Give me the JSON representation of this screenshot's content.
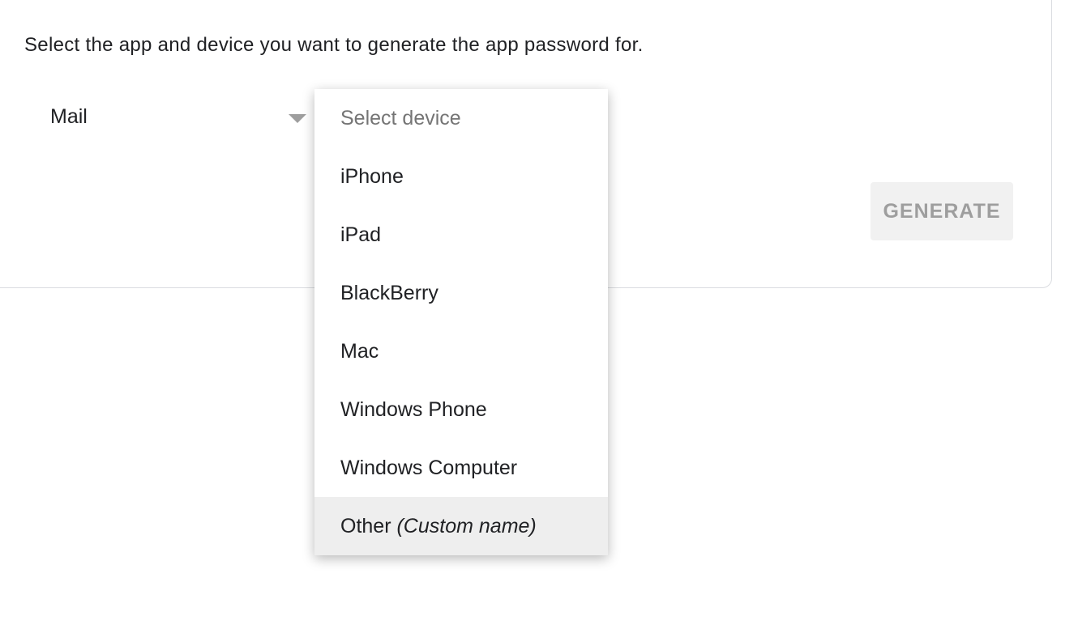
{
  "intro": "Select the app and device you want to generate the app password for.",
  "app_select": {
    "value": "Mail"
  },
  "generate_label": "GENERATE",
  "device_menu": {
    "placeholder": "Select device",
    "items": [
      "iPhone",
      "iPad",
      "BlackBerry",
      "Mac",
      "Windows Phone",
      "Windows Computer"
    ],
    "other": {
      "label": "Other",
      "hint": "(Custom name)"
    }
  },
  "colors": {
    "highlight": "#eeeeee",
    "disabled_text": "#9e9e9e"
  }
}
